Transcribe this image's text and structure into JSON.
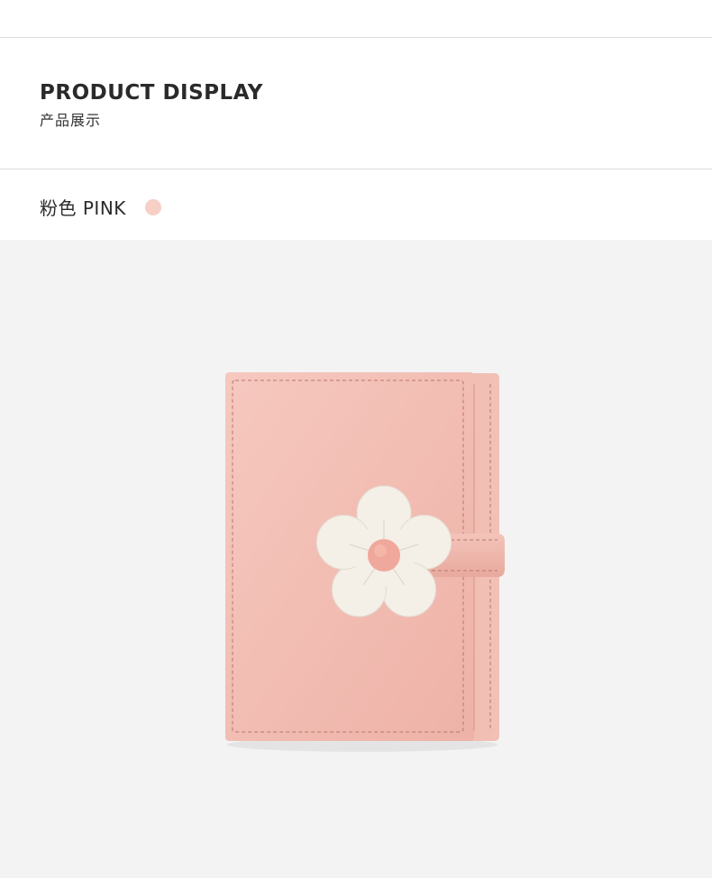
{
  "section": {
    "title_en": "PRODUCT DISPLAY",
    "title_cn": "产品展示"
  },
  "variant": {
    "label": "粉色 PINK",
    "swatch_color": "#f6cfc6"
  },
  "product": {
    "image": "pink-flower-wallet",
    "body_color": "#f2bdb3",
    "flower_color": "#f4efe7",
    "button_color": "#f0a89c",
    "background_color": "#f3f3f3"
  }
}
